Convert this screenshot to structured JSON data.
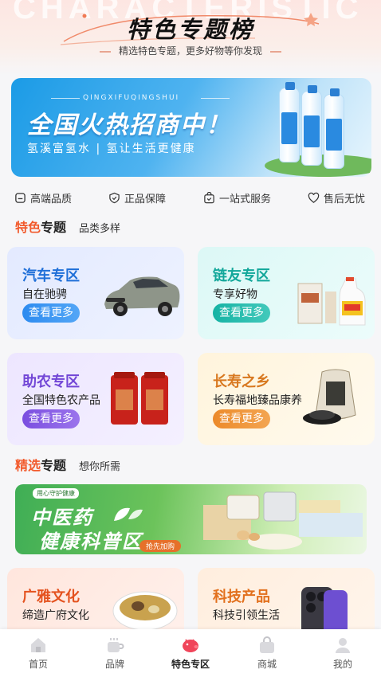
{
  "header": {
    "watermark": "CHARACTERISTIC",
    "title": "特色专题榜",
    "subtitle": "精选特色专题，更多好物等你发现"
  },
  "banner": {
    "pinyin": "QINGXIFUQINGSHUI",
    "title": "全国火热招商中！",
    "desc": "氢溪富氢水 | 氢让生活更健康"
  },
  "badges": [
    {
      "label": "高端品质",
      "icon": "diamond-icon"
    },
    {
      "label": "正品保障",
      "icon": "shield-check-icon"
    },
    {
      "label": "一站式服务",
      "icon": "bag-check-icon"
    },
    {
      "label": "售后无忧",
      "icon": "heart-icon"
    }
  ],
  "section1": {
    "highlight": "特色",
    "title": "专题",
    "tag": "品类多样"
  },
  "section2": {
    "highlight": "精选",
    "title": "专题",
    "tag": "想你所需"
  },
  "cards": {
    "car": {
      "title": "汽车专区",
      "subtitle": "自在驰骋",
      "button": "查看更多"
    },
    "link": {
      "title": "链友专区",
      "subtitle": "专享好物",
      "button": "查看更多"
    },
    "farm": {
      "title": "助农专区",
      "subtitle": "全国特色农产品",
      "button": "查看更多"
    },
    "long": {
      "title": "长寿之乡",
      "subtitle": "长寿福地臻品康养",
      "button": "查看更多"
    },
    "culture": {
      "title": "广雅文化",
      "subtitle": "缔造广府文化"
    },
    "tech": {
      "title": "科技产品",
      "subtitle": "科技引领生活"
    }
  },
  "promo": {
    "tag": "用心守护健康",
    "line1": "中医药",
    "line2": "健康科普区",
    "button": "抢先加购"
  },
  "tabbar": {
    "items": [
      {
        "label": "首页",
        "icon": "home-icon"
      },
      {
        "label": "品牌",
        "icon": "brand-cup-icon"
      },
      {
        "label": "特色专区",
        "icon": "piggy-icon"
      },
      {
        "label": "商城",
        "icon": "shopping-bag-icon"
      },
      {
        "label": "我的",
        "icon": "user-icon"
      }
    ],
    "active_index": 2
  },
  "colors": {
    "accent": "#f25a2c",
    "car": "#1f6fd8",
    "link": "#12a79a",
    "farm": "#7246d6",
    "long": "#d8781f"
  }
}
